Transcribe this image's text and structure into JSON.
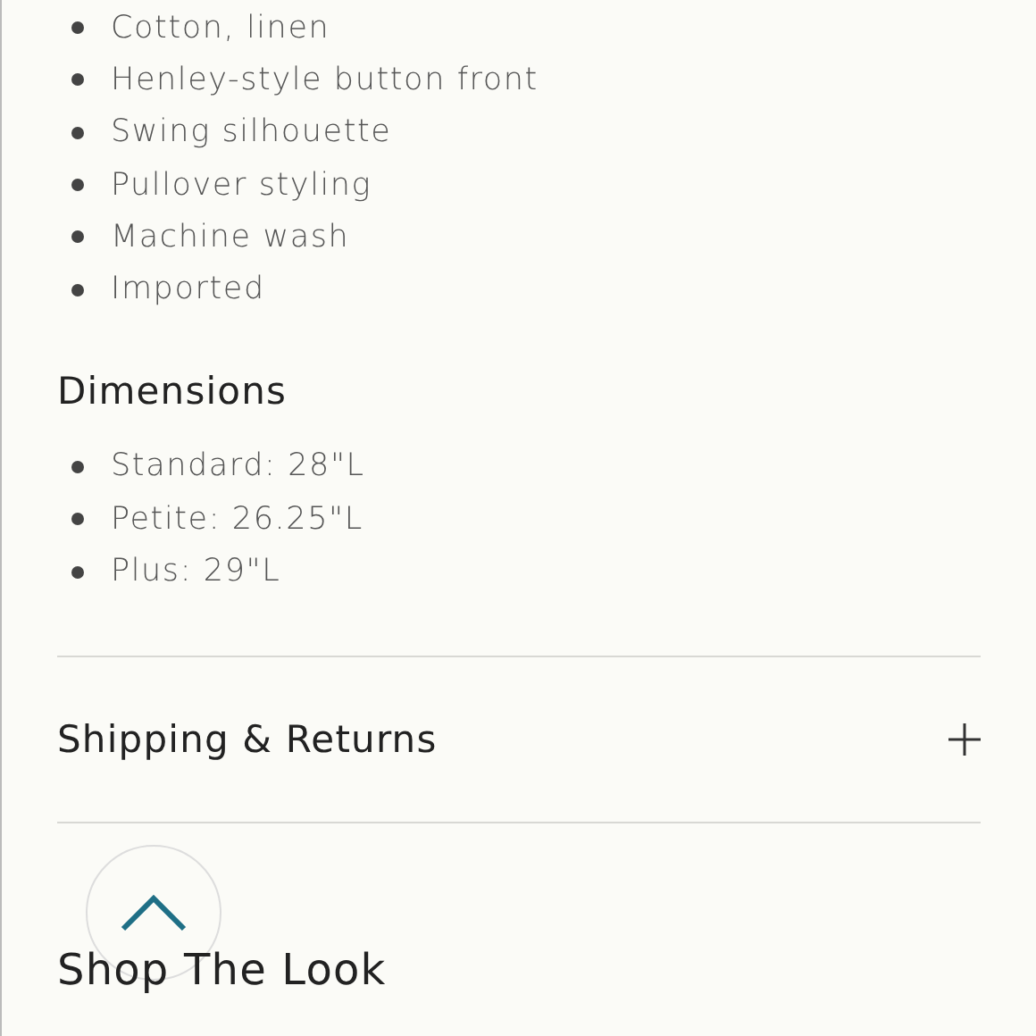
{
  "features": [
    "Cotton, linen",
    "Henley-style button front",
    "Swing silhouette",
    "Pullover styling",
    "Machine wash",
    "Imported"
  ],
  "dimensions": {
    "heading": "Dimensions",
    "items": [
      "Standard: 28\"L",
      "Petite: 26.25\"L",
      "Plus: 29\"L"
    ]
  },
  "accordion": [
    {
      "label": "Shipping & Returns",
      "expanded": false
    }
  ],
  "section_heading": "Shop The Look"
}
